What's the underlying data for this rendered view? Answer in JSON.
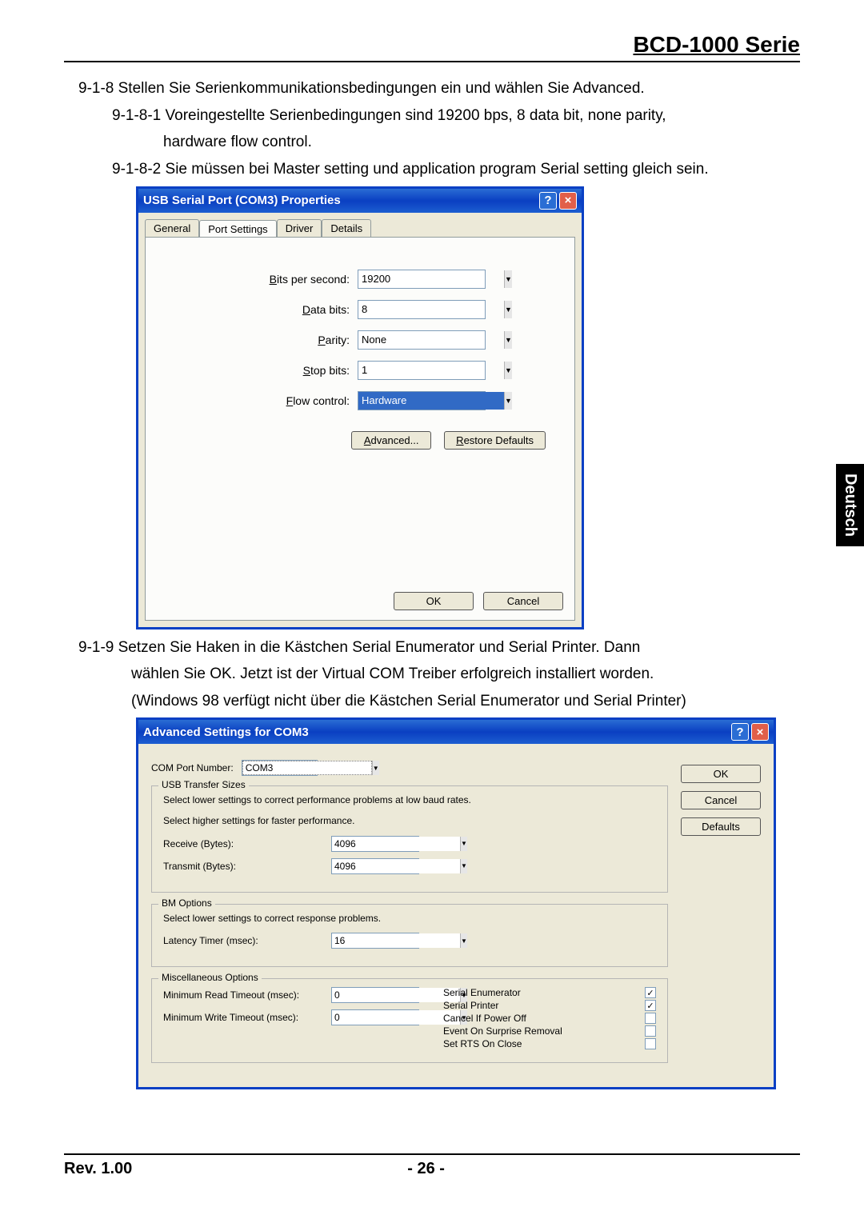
{
  "header": {
    "title": "BCD-1000 Serie"
  },
  "side_tab": "Deutsch",
  "text": {
    "p918": "9-1-8 Stellen Sie Serienkommunikationsbedingungen ein und wählen Sie Advanced.",
    "p9181": "9-1-8-1 Voreingestellte Serienbedingungen sind 19200 bps, 8 data bit, none parity,",
    "p9181b": "hardware flow control.",
    "p9182": "9-1-8-2 Sie müssen bei Master setting und application program Serial setting gleich sein.",
    "p919": "9-1-9 Setzen Sie Haken in die Kästchen Serial Enumerator und Serial Printer. Dann",
    "p919b": "wählen Sie OK. Jetzt ist der Virtual COM Treiber erfolgreich installiert worden.",
    "p919c": "(Windows 98 verfügt nicht über die Kästchen Serial Enumerator und Serial Printer)"
  },
  "dialog1": {
    "title": "USB Serial Port (COM3) Properties",
    "tabs": [
      "General",
      "Port Settings",
      "Driver",
      "Details"
    ],
    "fields": {
      "bps_label": "Bits per second:",
      "bps_value": "19200",
      "data_label": "Data bits:",
      "data_value": "8",
      "parity_label": "Parity:",
      "parity_value": "None",
      "stop_label": "Stop bits:",
      "stop_value": "1",
      "flow_label": "Flow control:",
      "flow_value": "Hardware"
    },
    "advanced_btn": "Advanced...",
    "restore_btn": "Restore Defaults",
    "ok_btn": "OK",
    "cancel_btn": "Cancel"
  },
  "dialog2": {
    "title": "Advanced Settings for COM3",
    "com_label": "COM Port Number:",
    "com_value": "COM3",
    "ok_btn": "OK",
    "cancel_btn": "Cancel",
    "defaults_btn": "Defaults",
    "usb_legend": "USB Transfer Sizes",
    "usb_hint1": "Select lower settings to correct performance problems at low baud rates.",
    "usb_hint2": "Select higher settings for faster performance.",
    "recv_label": "Receive (Bytes):",
    "recv_value": "4096",
    "trans_label": "Transmit (Bytes):",
    "trans_value": "4096",
    "bm_legend": "BM Options",
    "bm_hint": "Select lower settings to correct response problems.",
    "lat_label": "Latency Timer (msec):",
    "lat_value": "16",
    "misc_legend": "Miscellaneous Options",
    "minr_label": "Minimum Read Timeout (msec):",
    "minr_value": "0",
    "minw_label": "Minimum Write Timeout (msec):",
    "minw_value": "0",
    "checks": {
      "serial_enum": "Serial Enumerator",
      "serial_printer": "Serial Printer",
      "cancel_power": "Cancel If Power Off",
      "event_surprise": "Event On Surprise Removal",
      "set_rts": "Set RTS On Close"
    }
  },
  "footer": {
    "rev": "Rev. 1.00",
    "page": "- 26 -"
  }
}
